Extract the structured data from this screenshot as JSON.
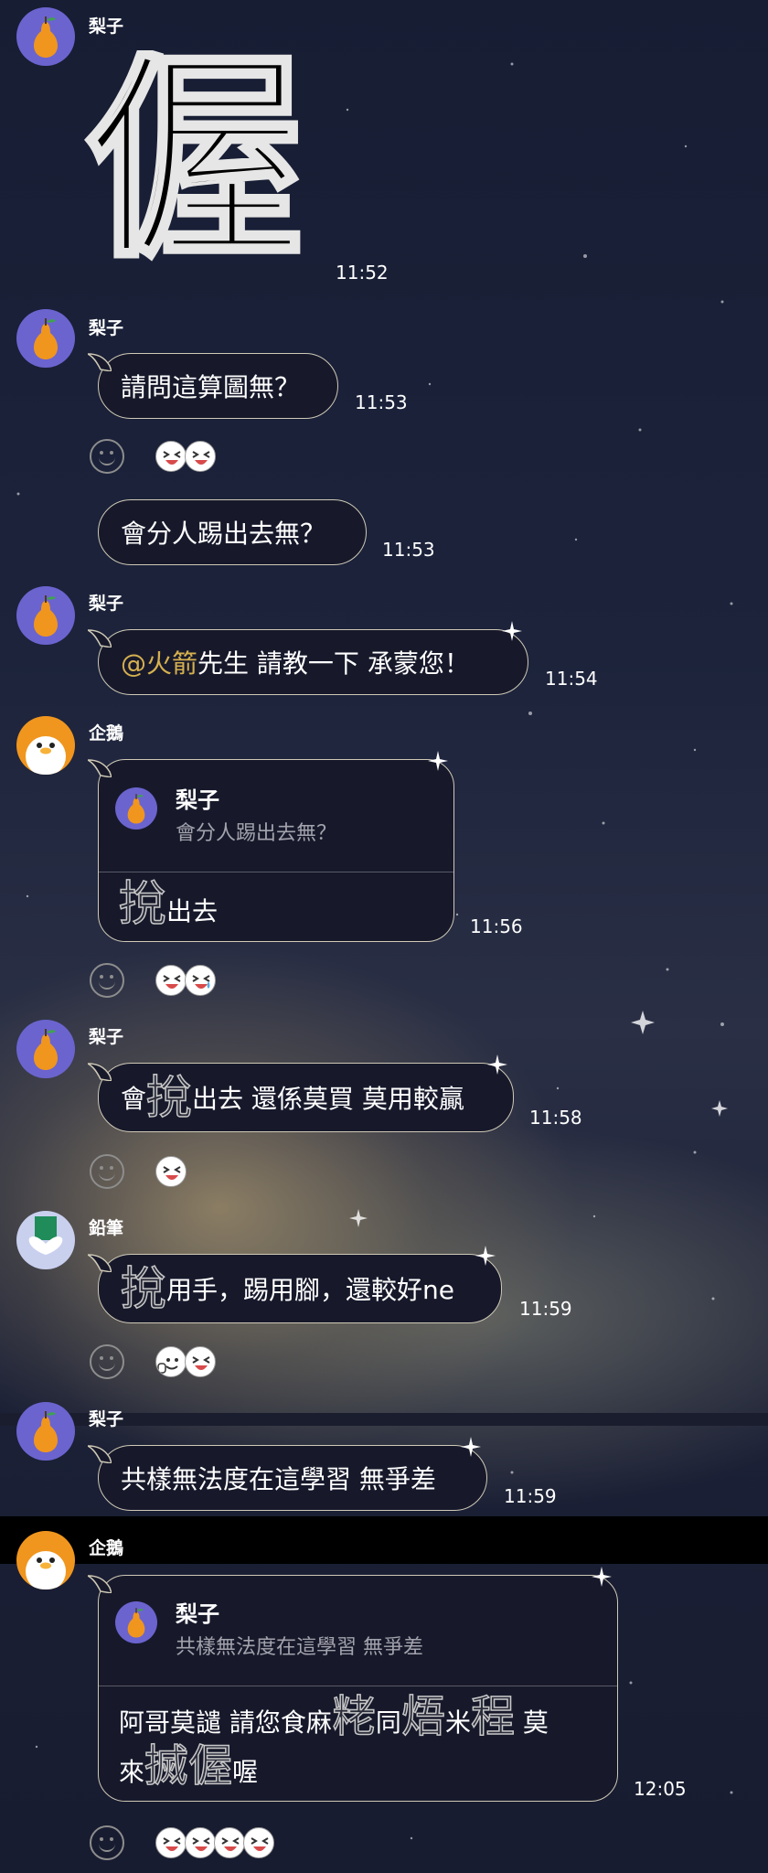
{
  "colors": {
    "background": "#1c233b",
    "bubble_bg": "#17192b",
    "bubble_border": "#cfc9b6",
    "mention": "#d6b04f",
    "quote_text": "#a3a3ad"
  },
  "users": {
    "pear": "梨子",
    "penguin": "企鵝",
    "pencil": "鉛筆"
  },
  "messages": [
    {
      "sender": "梨子",
      "big_char": "偓",
      "time": "11:52"
    },
    {
      "sender": "梨子",
      "text": "請問這算圖無？",
      "time": "11:53"
    },
    {
      "text": "會分人踢出去無？",
      "time": "11:53"
    },
    {
      "sender": "梨子",
      "mention": "@火箭",
      "text": " 先生 請教一下 承蒙您！",
      "time": "11:54"
    },
    {
      "sender": "企鵝",
      "quote_name": "梨子",
      "quote_text": "會分人踢出去無？",
      "rare_char": "挩",
      "text": "出去",
      "time": "11:56"
    },
    {
      "sender": "梨子",
      "pre": "會",
      "rare_char": "挩",
      "text": "出去 還係莫買 莫用較贏",
      "time": "11:58"
    },
    {
      "sender": "鉛筆",
      "rare_char": "挩",
      "text": "用手，踢用腳，還較好ne",
      "time": "11:59"
    },
    {
      "sender": "梨子",
      "text": "共樣無法度在這學習 無爭差",
      "time": "11:59"
    },
    {
      "sender": "企鵝",
      "quote_name": "梨子",
      "quote_text": "共樣無法度在這學習 無爭差",
      "l1a": "阿哥莫譴 請您食麻",
      "r1": "粩",
      "l1b": "同",
      "r2": "焐",
      "l1c": "米",
      "r3": "程",
      "l1d": " 莫",
      "l2a": "來",
      "r4": "搣偓",
      "l2b": "喔",
      "time": "12:05"
    }
  ],
  "reactions": {
    "r1": [
      "laugh-icon",
      "laugh-icon"
    ],
    "r2": [
      "laugh-icon",
      "cry-laugh-icon"
    ],
    "r3": [
      "laugh-icon"
    ],
    "r4": [
      "thumbs-up-icon",
      "laugh-icon"
    ],
    "r5": [
      "laugh-icon",
      "laugh-icon",
      "laugh-icon",
      "laugh-icon"
    ]
  }
}
